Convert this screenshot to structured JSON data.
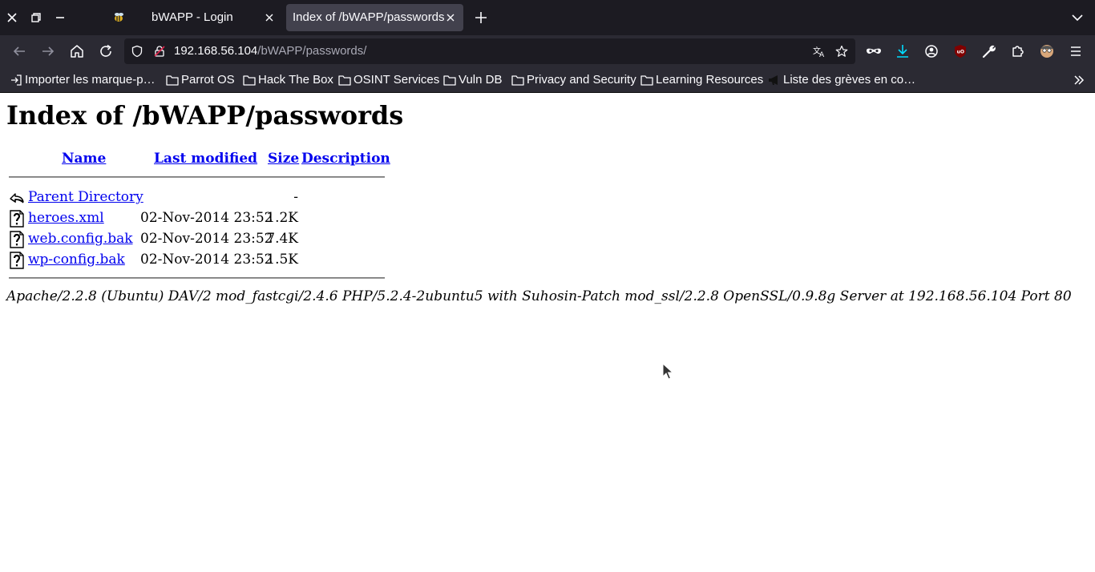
{
  "browser": {
    "tabs": [
      {
        "title": "bWAPP - Login",
        "active": false
      },
      {
        "title": "Index of /bWAPP/passwords",
        "active": true
      }
    ],
    "url": {
      "host": "192.168.56.104",
      "path": "/bWAPP/passwords/"
    },
    "bookmarks": [
      {
        "label": "Importer les marque-p…",
        "icon": "import-icon"
      },
      {
        "label": "Parrot OS",
        "icon": "folder-icon"
      },
      {
        "label": "Hack The Box",
        "icon": "folder-icon"
      },
      {
        "label": "OSINT Services",
        "icon": "folder-icon"
      },
      {
        "label": "Vuln DB",
        "icon": "folder-icon"
      },
      {
        "label": "Privacy and Security",
        "icon": "folder-icon"
      },
      {
        "label": "Learning Resources",
        "icon": "folder-icon"
      },
      {
        "label": "Liste des grèves en co…",
        "icon": "megaphone-icon"
      }
    ]
  },
  "page": {
    "title": "Index of /bWAPP/passwords",
    "columns": {
      "name": "Name",
      "last_modified": "Last modified",
      "size": "Size",
      "description": "Description"
    },
    "entries": [
      {
        "name": "Parent Directory",
        "modified": "",
        "size": "-",
        "icon": "back-icon"
      },
      {
        "name": "heroes.xml",
        "modified": "02-Nov-2014 23:52",
        "size": "1.2K",
        "icon": "unknown-file-icon"
      },
      {
        "name": "web.config.bak",
        "modified": "02-Nov-2014 23:52",
        "size": "7.4K",
        "icon": "unknown-file-icon"
      },
      {
        "name": "wp-config.bak",
        "modified": "02-Nov-2014 23:52",
        "size": "1.5K",
        "icon": "unknown-file-icon"
      }
    ],
    "footer": "Apache/2.2.8 (Ubuntu) DAV/2 mod_fastcgi/2.4.6 PHP/5.2.4-2ubuntu5 with Suhosin-Patch mod_ssl/2.2.8 OpenSSL/0.9.8g Server at 192.168.56.104 Port 80"
  },
  "colors": {
    "link": "#0000ee",
    "chrome_dark": "#1c1b22",
    "toolbar": "#2b2a33",
    "active_tab": "#42414d"
  }
}
